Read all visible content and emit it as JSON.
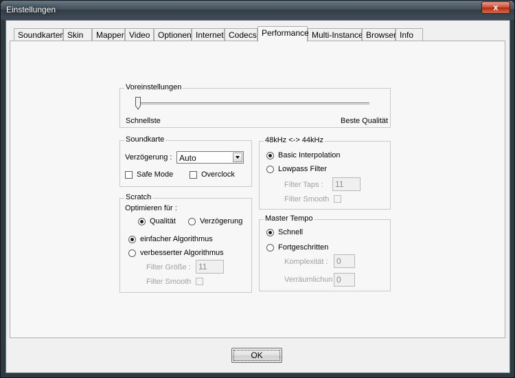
{
  "window": {
    "title": "Einstellungen",
    "close_label": "x"
  },
  "tabs": [
    {
      "label": "Soundkarten"
    },
    {
      "label": "Skin"
    },
    {
      "label": "Mapper"
    },
    {
      "label": "Video"
    },
    {
      "label": "Optionen"
    },
    {
      "label": "Internet"
    },
    {
      "label": "Codecs"
    },
    {
      "label": "Performance"
    },
    {
      "label": "Multi-Instance"
    },
    {
      "label": "Browser"
    },
    {
      "label": "Info"
    }
  ],
  "active_tab": "Performance",
  "voreinstellungen": {
    "title": "Voreinstellungen",
    "left_label": "Schnellste",
    "right_label": "Beste Qualität",
    "slider_position": 0
  },
  "soundkarte": {
    "title": "Soundkarte",
    "delay_label": "Verzögerung :",
    "delay_value": "Auto",
    "safe_mode_label": "Safe Mode",
    "safe_mode_checked": false,
    "overclock_label": "Overclock",
    "overclock_checked": false
  },
  "scratch": {
    "title": "Scratch",
    "optimize_label": "Optimieren für :",
    "quality_label": "Qualität",
    "delay_label": "Verzögerung",
    "optimize_selected": "Qualität",
    "simple_algo_label": "einfacher Algorithmus",
    "improved_algo_label": "verbesserter Algorithmus",
    "algo_selected": "einfacher Algorithmus",
    "filter_size_label": "Filter Größe :",
    "filter_size_value": "11",
    "filter_smooth_label": "Filter Smooth"
  },
  "resample": {
    "title": "48kHz <-> 44kHz",
    "basic_label": "Basic Interpolation",
    "lowpass_label": "Lowpass Filter",
    "selected": "Basic Interpolation",
    "filter_taps_label": "Filter Taps :",
    "filter_taps_value": "11",
    "filter_smooth_label": "Filter Smooth"
  },
  "master_tempo": {
    "title": "Master Tempo",
    "fast_label": "Schnell",
    "advanced_label": "Fortgeschritten",
    "selected": "Schnell",
    "complexity_label": "Komplexität :",
    "complexity_value": "0",
    "spatial_label": "Verräumlichung",
    "spatial_value": "0"
  },
  "buttons": {
    "ok_label": "OK"
  }
}
